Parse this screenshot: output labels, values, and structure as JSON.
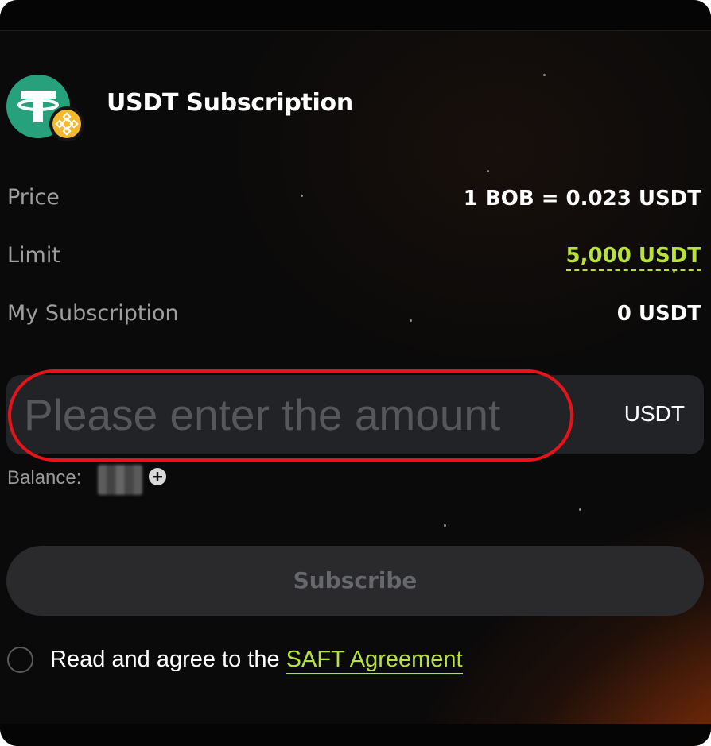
{
  "header": {
    "title": "USDT Subscription",
    "token_icon": "tether-usdt-logo",
    "chain_badge_icon": "bnb-chain-badge"
  },
  "info": {
    "price_label": "Price",
    "price_value": "1 BOB = 0.023 USDT",
    "limit_label": "Limit",
    "limit_value": "5,000 USDT",
    "subscription_label": "My Subscription",
    "subscription_value": "0 USDT"
  },
  "amount": {
    "placeholder": "Please enter the amount",
    "value": "",
    "unit": "USDT"
  },
  "balance": {
    "label": "Balance:",
    "add_icon": "plus-circle-icon"
  },
  "subscribe_button": {
    "label": "Subscribe"
  },
  "agreement": {
    "text": "Read and agree to the ",
    "link_label": "SAFT Agreement",
    "checked": false
  },
  "colors": {
    "accent_green": "#b8e13a",
    "highlight_red": "#e3151a",
    "tether_green": "#26a17b",
    "bnb_yellow": "#f3ba2f"
  }
}
